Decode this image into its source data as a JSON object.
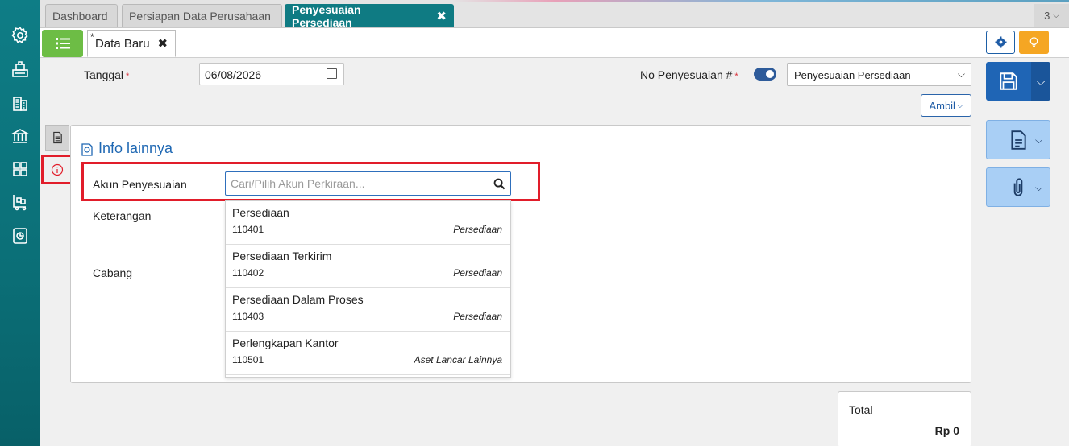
{
  "sidebar": {
    "icons": [
      "settings-icon",
      "cashier-icon",
      "building-icon",
      "bank-icon",
      "inventory-icon",
      "cart-icon",
      "report-icon"
    ]
  },
  "tabs": [
    {
      "label": "Dashboard",
      "active": false
    },
    {
      "label": "Persiapan Data Perusahaan",
      "active": false
    },
    {
      "label": "Penyesuaian Persediaan",
      "active": true
    }
  ],
  "tab_count": "3",
  "doc_tab": {
    "star": "*",
    "label": "Data Baru"
  },
  "form": {
    "tanggal_label": "Tanggal",
    "tanggal_value": "06/08/2026",
    "no_label": "No Penyesuaian #",
    "type_select": "Penyesuaian Persediaan",
    "ambil_label": "Ambil",
    "required_mark": "*"
  },
  "panel": {
    "title": "Info lainnya",
    "akun_label": "Akun Penyesuaian",
    "search_placeholder": "Cari/Pilih Akun Perkiraan...",
    "keterangan_label": "Keterangan",
    "cabang_label": "Cabang"
  },
  "dropdown": [
    {
      "name": "Persediaan",
      "code": "110401",
      "category": "Persediaan"
    },
    {
      "name": "Persediaan Terkirim",
      "code": "110402",
      "category": "Persediaan"
    },
    {
      "name": "Persediaan Dalam Proses",
      "code": "110403",
      "category": "Persediaan"
    },
    {
      "name": "Perlengkapan Kantor",
      "code": "110501",
      "category": "Aset Lancar Lainnya"
    }
  ],
  "total": {
    "label": "Total",
    "value": "Rp 0"
  },
  "colors": {
    "sidebar": "#0e7d86",
    "active_tab": "#0f7b83",
    "primary": "#1f65b5",
    "highlight": "#e11d2a",
    "list_button": "#6dbd45",
    "bulb_button": "#f5a623"
  }
}
